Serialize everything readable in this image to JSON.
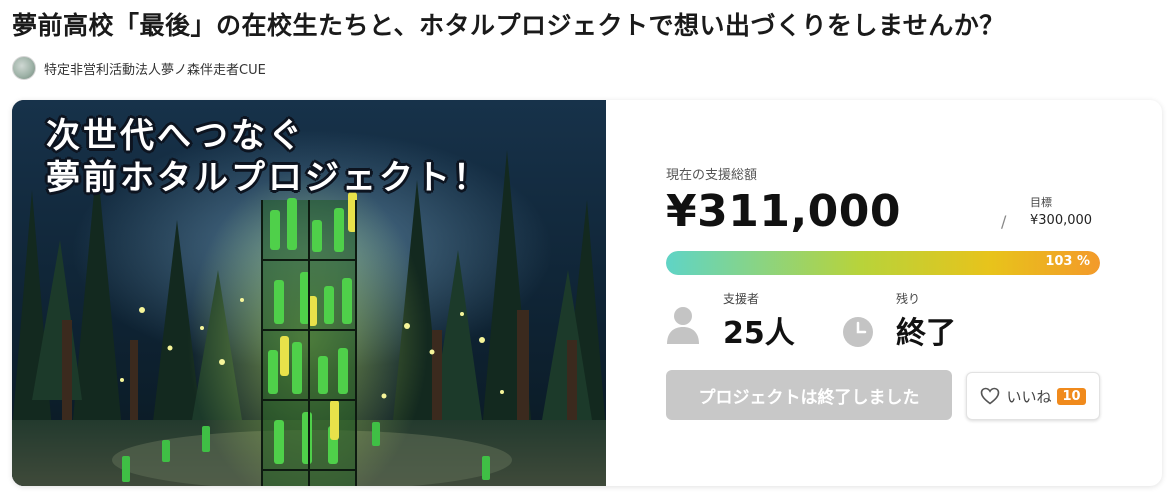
{
  "project": {
    "title": "夢前高校「最後」の在校生たちと、ホタルプロジェクトで想い出づくりをしませんか？",
    "owner": "特定非営利活動法人夢ノ森伴走者CUE"
  },
  "hero": {
    "caption_line1": "次世代へつなぐ",
    "caption_line2": "夢前ホタルプロジェクト！"
  },
  "stats": {
    "total_label": "現在の支援総額",
    "total_amount": "¥311,000",
    "slash": "/",
    "goal_label": "目標",
    "goal_amount": "¥300,000",
    "progress_percent_text": "103 %",
    "progress_fraction": 1.03,
    "backers_label": "支援者",
    "backers_value": "25人",
    "remaining_label": "残り",
    "remaining_value": "終了"
  },
  "actions": {
    "ended_button": "プロジェクトは終了しました",
    "like_label": "いいね",
    "like_count": "10"
  },
  "colors": {
    "progress_gradient": [
      "#5fd4c6",
      "#b8d33a",
      "#e8c31b",
      "#f39a2a"
    ],
    "like_badge": "#f08a1c",
    "disabled_button": "#c8c8c8"
  },
  "icons": [
    "avatar",
    "person-icon",
    "clock-icon",
    "heart-icon"
  ]
}
